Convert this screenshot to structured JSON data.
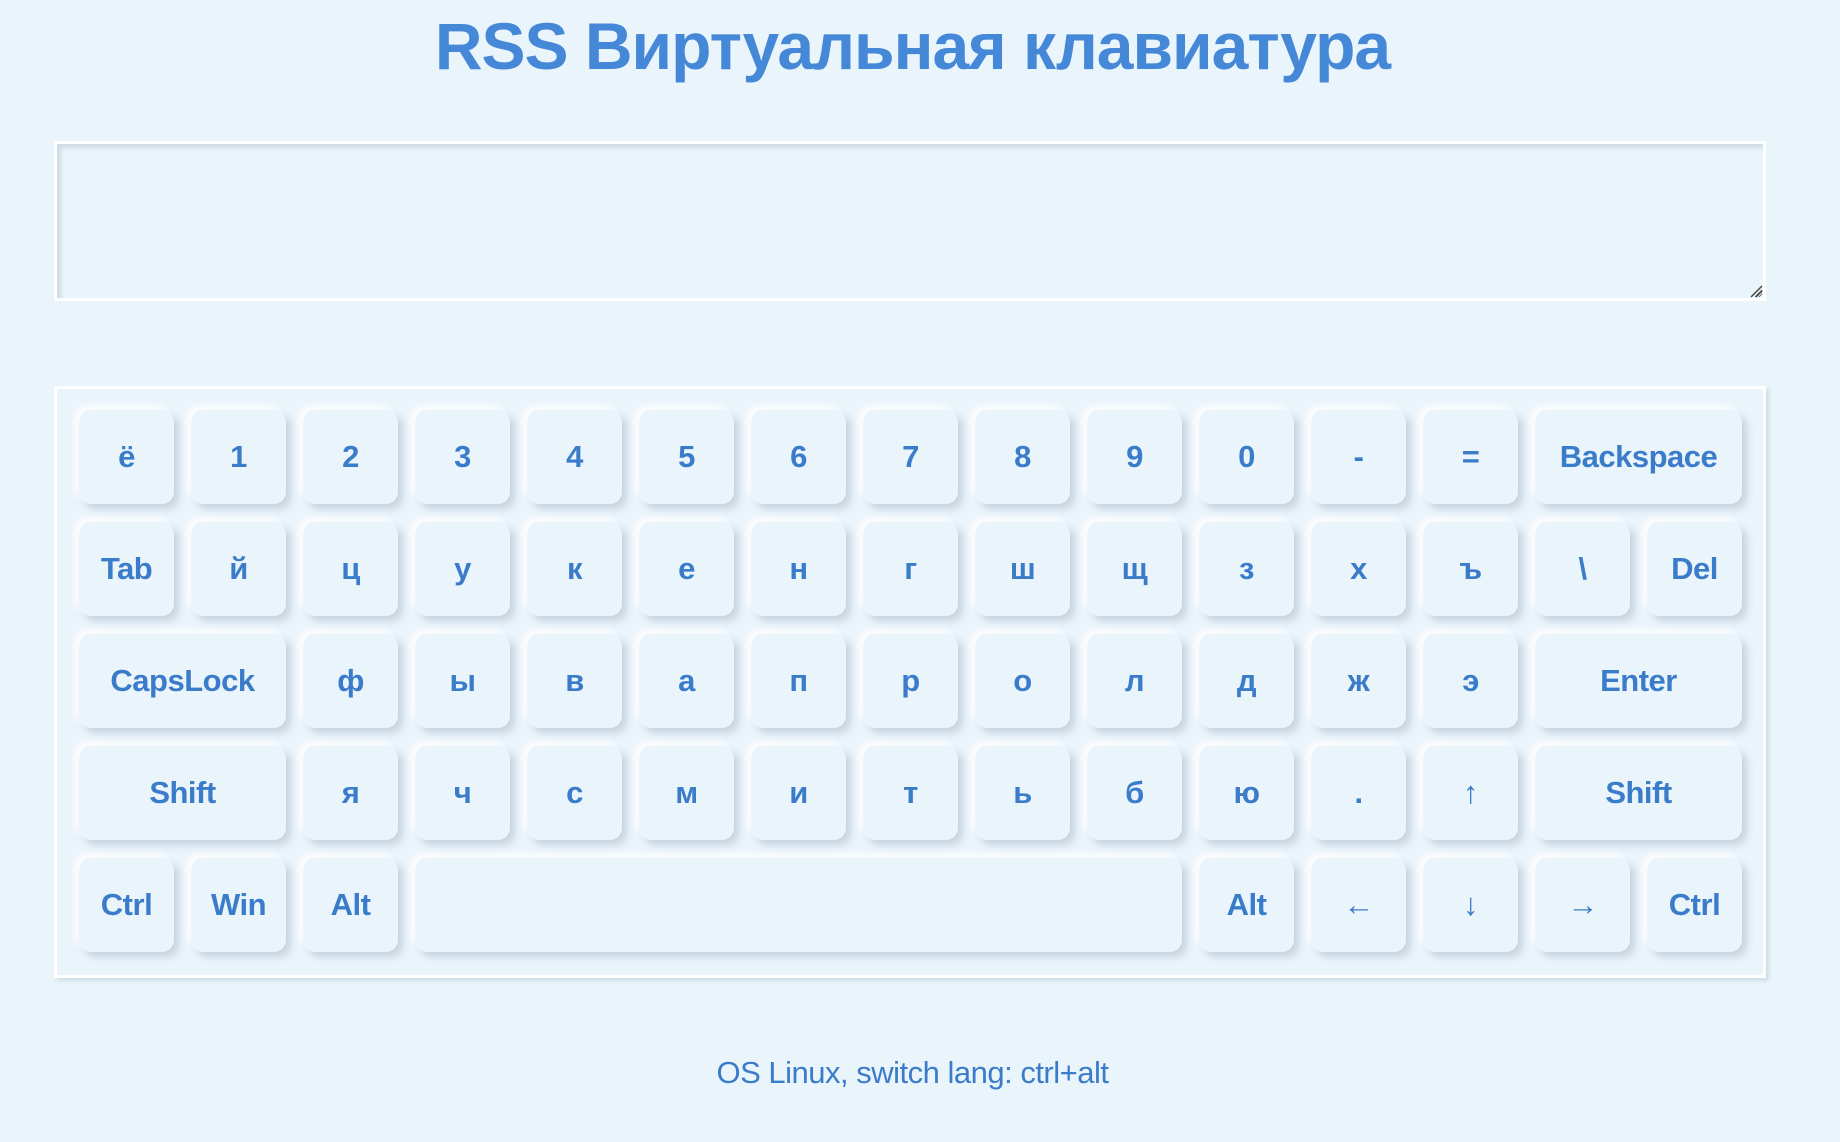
{
  "header": {
    "title": "RSS Виртуальная клавиатура"
  },
  "input": {
    "value": "",
    "placeholder": ""
  },
  "keyboard": {
    "rows": [
      [
        "ё",
        "1",
        "2",
        "3",
        "4",
        "5",
        "6",
        "7",
        "8",
        "9",
        "0",
        "-",
        "=",
        "Backspace"
      ],
      [
        "Tab",
        "й",
        "ц",
        "у",
        "к",
        "е",
        "н",
        "г",
        "ш",
        "щ",
        "з",
        "х",
        "ъ",
        "\\",
        "Del"
      ],
      [
        "CapsLock",
        "ф",
        "ы",
        "в",
        "а",
        "п",
        "р",
        "о",
        "л",
        "д",
        "ж",
        "э",
        "Enter"
      ],
      [
        "Shift",
        "я",
        "ч",
        "с",
        "м",
        "и",
        "т",
        "ь",
        "б",
        "ю",
        ".",
        "↑",
        "Shift"
      ],
      [
        "Ctrl",
        "Win",
        "Alt",
        " ",
        "Alt",
        "←",
        "↓",
        "→",
        "Ctrl"
      ]
    ]
  },
  "footer": {
    "note": "OS Linux, switch lang: ctrl+alt"
  },
  "colors": {
    "accent": "#4588d8",
    "background": "#eaf4fb"
  }
}
